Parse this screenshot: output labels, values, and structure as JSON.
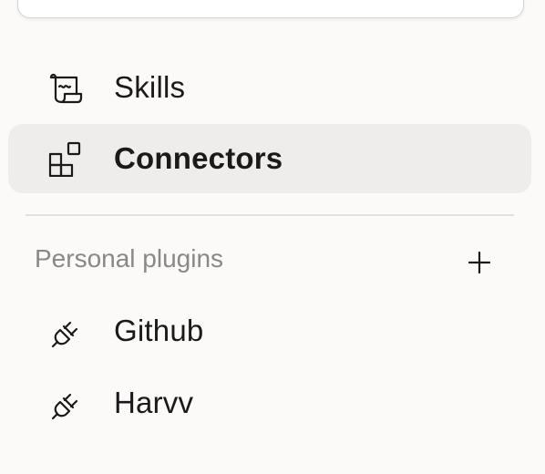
{
  "nav": {
    "items": [
      {
        "label": "Skills",
        "icon": "scroll-icon",
        "active": false
      },
      {
        "label": "Connectors",
        "icon": "connectors-icon",
        "active": true
      }
    ]
  },
  "plugins": {
    "section_title": "Personal plugins",
    "add_icon": "plus-icon",
    "items": [
      {
        "label": "Github",
        "icon": "plug-icon"
      },
      {
        "label": "Harvv",
        "icon": "plug-icon"
      }
    ]
  },
  "colors": {
    "background": "#fbfaf8",
    "active_background": "#eeedeb",
    "text": "#1a1a1a",
    "muted_text": "#8b8884",
    "divider": "#e3e1dc"
  }
}
